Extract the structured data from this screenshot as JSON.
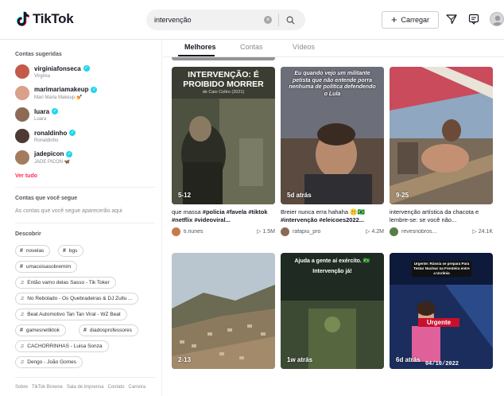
{
  "header": {
    "logo_text": "TikTok",
    "search_value": "intervenção",
    "upload_label": "Carregar",
    "icons": [
      "tiktok-logo-icon",
      "search-icon",
      "clear-icon",
      "plus-icon",
      "send-icon",
      "inbox-icon",
      "profile-avatar"
    ]
  },
  "sidebar": {
    "suggested_title": "Contas sugeridas",
    "accounts": [
      {
        "name": "virginiafonseca",
        "sub": "Virginia",
        "color": "#c45a4a"
      },
      {
        "name": "marimariamakeup",
        "sub": "Mari Maria Makeup 💅",
        "color": "#d9a08a"
      },
      {
        "name": "luara",
        "sub": "Luara",
        "color": "#8d6a55"
      },
      {
        "name": "ronaldinho",
        "sub": "Ronaldinho",
        "color": "#4c3a33"
      },
      {
        "name": "jadepicon",
        "sub": "JADE PICON 🦋",
        "color": "#a37b5e"
      }
    ],
    "see_all": "Ver tudo",
    "following_title": "Contas que você segue",
    "following_empty": "As contas que você segue aparecerão aqui",
    "discover_title": "Descobrir",
    "discover": [
      {
        "icon": "#",
        "label": "novelas"
      },
      {
        "icon": "#",
        "label": "bgs"
      },
      {
        "icon": "#",
        "label": "umacoisasobremim"
      },
      {
        "icon": "♫",
        "label": "Então vamo delas Sasso - Tik Toker"
      },
      {
        "icon": "♫",
        "label": "No Rebolado - Os Quebradeiras & DJ Zullu ..."
      },
      {
        "icon": "♫",
        "label": "Beat Automotivo Tan Tan Viral - WZ Beat"
      },
      {
        "icon": "#",
        "label": "gamesnetiktok"
      },
      {
        "icon": "#",
        "label": "diadosprofessores"
      },
      {
        "icon": "♫",
        "label": "CACHORRINHAS - Luisa Sonza"
      },
      {
        "icon": "♫",
        "label": "Dengo - João Gomes"
      }
    ],
    "footer": [
      "Sobre",
      "TikTok Browse",
      "Sala de imprensa",
      "Contato",
      "Carreira"
    ]
  },
  "tabs": [
    "Melhores",
    "Contas",
    "Vídeos"
  ],
  "videos": [
    {
      "time": "5-12",
      "caption_pre": "que massa ",
      "caption_bold": "#policia #favela #tiktok #netflix #videoviral...",
      "caption_post": "",
      "user": "ti.nunes",
      "views": "1.5M",
      "overlay_title": "INTERVENÇÃO: É PROIBIDO MORRER",
      "overlay_sub": "de Caio Coltro (2021)"
    },
    {
      "time": "5d atrás",
      "caption_pre": "Breier nunca erra hahaha 🤫🇧🇷 ",
      "caption_bold": "#intervenção #eleicoes2022...",
      "caption_post": "",
      "user": "rafapiu_pro",
      "views": "4.2M",
      "overlay_title": "Eu quando vejo um militante petista que não entende porra nenhuma de política defendendo o Lula",
      "overlay_sub": ""
    },
    {
      "time": "9-25",
      "caption_pre": "intervenção artística da chacota e lembre-se: se você não...",
      "caption_bold": "",
      "caption_post": "",
      "user": "revesnobros...",
      "views": "24.1K",
      "overlay_title": "",
      "overlay_sub": ""
    },
    {
      "time": "2-13",
      "caption_pre": "",
      "caption_bold": "",
      "caption_post": "",
      "user": "",
      "views": "",
      "overlay_title": "",
      "overlay_sub": ""
    },
    {
      "time": "1w atrás",
      "caption_pre": "",
      "caption_bold": "",
      "caption_post": "",
      "user": "",
      "views": "",
      "overlay_title": "Ajuda a gente aí exército. 🇧🇷 Intervenção já!",
      "overlay_sub": ""
    },
    {
      "time": "6d atrás",
      "caption_pre": "",
      "caption_bold": "",
      "caption_post": "",
      "user": "",
      "views": "",
      "overlay_title": "Urgente: Rússia se prepara Para Testar Nuclear na Fronteira entre a Ucrânia",
      "overlay_sub": "Urgente",
      "overlay_date": "04/10/2022"
    }
  ],
  "colors": {
    "accent": "#fe2c55",
    "verified": "#20d5ec",
    "text": "#161823",
    "muted": "#8a8b91"
  }
}
